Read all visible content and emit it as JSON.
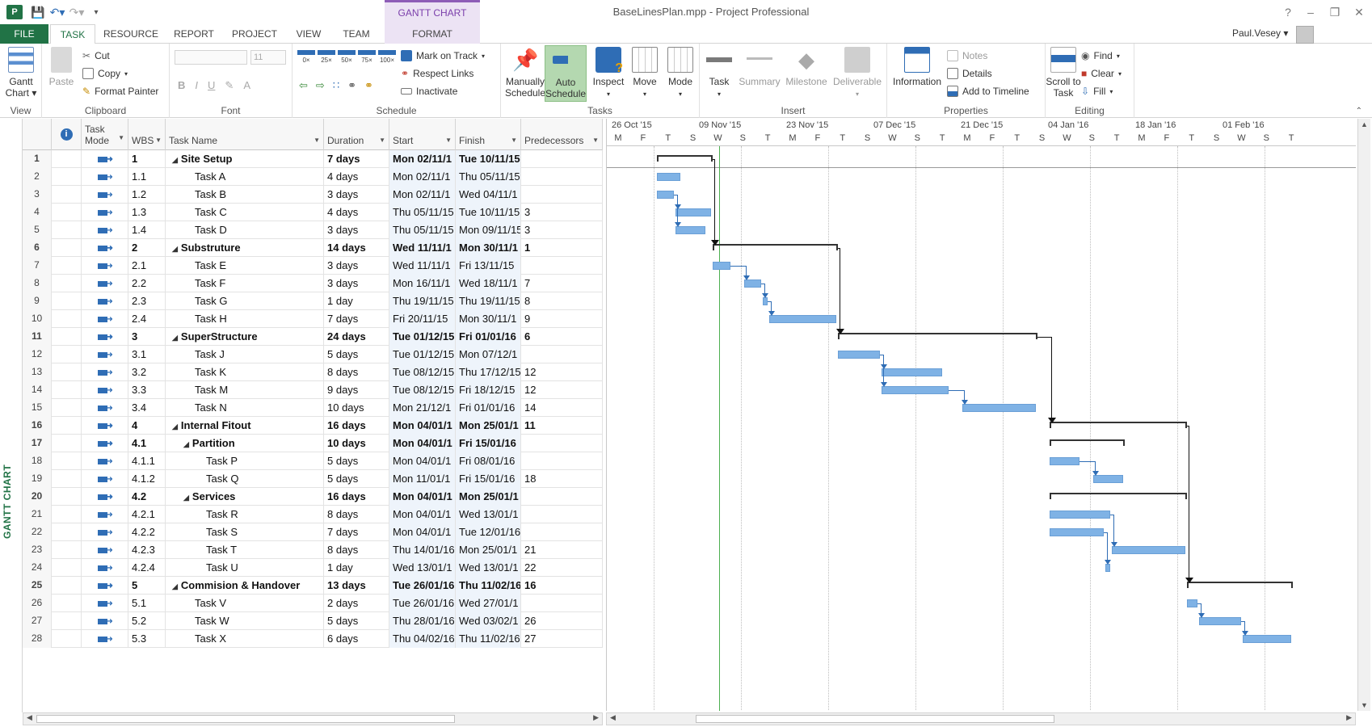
{
  "window": {
    "title": "BaseLinesPlan.mpp - Project Professional",
    "context_tab_title": "GANTT CHART TOOLS",
    "user": "Paul.Vesey",
    "help": "?",
    "minimize": "–",
    "restore": "❐",
    "close": "✕"
  },
  "tabs": [
    "FILE",
    "TASK",
    "RESOURCE",
    "REPORT",
    "PROJECT",
    "VIEW",
    "TEAM",
    "FORMAT"
  ],
  "ribbon": {
    "view": {
      "label": "View",
      "gantt_chart": "Gantt Chart ▾"
    },
    "clipboard": {
      "label": "Clipboard",
      "paste": "Paste",
      "cut": "Cut",
      "copy": "Copy",
      "format_painter": "Format Painter"
    },
    "font": {
      "label": "Font",
      "size": "11",
      "bold": "B",
      "italic": "I",
      "underline": "U",
      "font_color": "A"
    },
    "schedule": {
      "label": "Schedule",
      "pct": [
        "0×",
        "25×",
        "50×",
        "75×",
        "100×"
      ],
      "mark_on_track": "Mark on Track",
      "respect_links": "Respect Links",
      "inactivate": "Inactivate"
    },
    "tasks": {
      "label": "Tasks",
      "manually_schedule": "Manually Schedule",
      "auto_schedule": "Auto Schedule",
      "inspect": "Inspect",
      "move": "Move",
      "mode": "Mode"
    },
    "insert": {
      "label": "Insert",
      "task": "Task",
      "summary": "Summary",
      "milestone": "Milestone",
      "deliverable": "Deliverable"
    },
    "properties": {
      "label": "Properties",
      "information": "Information",
      "notes": "Notes",
      "details": "Details",
      "add_to_timeline": "Add to Timeline"
    },
    "editing": {
      "label": "Editing",
      "scroll_to_task": "Scroll to Task",
      "find": "Find",
      "clear": "Clear",
      "fill": "Fill"
    }
  },
  "view_bar_label": "GANTT CHART",
  "grid": {
    "headers": {
      "task_mode": "Task Mode",
      "wbs": "WBS",
      "task_name": "Task Name",
      "duration": "Duration",
      "start": "Start",
      "finish": "Finish",
      "predecessors": "Predecessors"
    },
    "rows": [
      {
        "id": "1",
        "wbs": "1",
        "name": "Site Setup",
        "dur": "7 days",
        "start": "Mon 02/11/1",
        "finish": "Tue 10/11/15",
        "pred": "",
        "lvl": 0,
        "sum": true
      },
      {
        "id": "2",
        "wbs": "1.1",
        "name": "Task A",
        "dur": "4 days",
        "start": "Mon 02/11/1",
        "finish": "Thu 05/11/15",
        "pred": "",
        "lvl": 1,
        "sum": false
      },
      {
        "id": "3",
        "wbs": "1.2",
        "name": "Task B",
        "dur": "3 days",
        "start": "Mon 02/11/1",
        "finish": "Wed 04/11/1",
        "pred": "",
        "lvl": 1,
        "sum": false
      },
      {
        "id": "4",
        "wbs": "1.3",
        "name": "Task C",
        "dur": "4 days",
        "start": "Thu 05/11/15",
        "finish": "Tue 10/11/15",
        "pred": "3",
        "lvl": 1,
        "sum": false
      },
      {
        "id": "5",
        "wbs": "1.4",
        "name": "Task D",
        "dur": "3 days",
        "start": "Thu 05/11/15",
        "finish": "Mon 09/11/15",
        "pred": "3",
        "lvl": 1,
        "sum": false
      },
      {
        "id": "6",
        "wbs": "2",
        "name": "Substruture",
        "dur": "14 days",
        "start": "Wed 11/11/1",
        "finish": "Mon 30/11/1",
        "pred": "1",
        "lvl": 0,
        "sum": true
      },
      {
        "id": "7",
        "wbs": "2.1",
        "name": "Task E",
        "dur": "3 days",
        "start": "Wed 11/11/1",
        "finish": "Fri 13/11/15",
        "pred": "",
        "lvl": 1,
        "sum": false
      },
      {
        "id": "8",
        "wbs": "2.2",
        "name": "Task F",
        "dur": "3 days",
        "start": "Mon 16/11/1",
        "finish": "Wed 18/11/1",
        "pred": "7",
        "lvl": 1,
        "sum": false
      },
      {
        "id": "9",
        "wbs": "2.3",
        "name": "Task G",
        "dur": "1 day",
        "start": "Thu 19/11/15",
        "finish": "Thu 19/11/15",
        "pred": "8",
        "lvl": 1,
        "sum": false
      },
      {
        "id": "10",
        "wbs": "2.4",
        "name": "Task H",
        "dur": "7 days",
        "start": "Fri 20/11/15",
        "finish": "Mon 30/11/1",
        "pred": "9",
        "lvl": 1,
        "sum": false
      },
      {
        "id": "11",
        "wbs": "3",
        "name": "SuperStructure",
        "dur": "24 days",
        "start": "Tue 01/12/15",
        "finish": "Fri 01/01/16",
        "pred": "6",
        "lvl": 0,
        "sum": true
      },
      {
        "id": "12",
        "wbs": "3.1",
        "name": "Task J",
        "dur": "5 days",
        "start": "Tue 01/12/15",
        "finish": "Mon 07/12/1",
        "pred": "",
        "lvl": 1,
        "sum": false
      },
      {
        "id": "13",
        "wbs": "3.2",
        "name": "Task K",
        "dur": "8 days",
        "start": "Tue 08/12/15",
        "finish": "Thu 17/12/15",
        "pred": "12",
        "lvl": 1,
        "sum": false
      },
      {
        "id": "14",
        "wbs": "3.3",
        "name": "Task M",
        "dur": "9 days",
        "start": "Tue 08/12/15",
        "finish": "Fri 18/12/15",
        "pred": "12",
        "lvl": 1,
        "sum": false
      },
      {
        "id": "15",
        "wbs": "3.4",
        "name": "Task N",
        "dur": "10 days",
        "start": "Mon 21/12/1",
        "finish": "Fri 01/01/16",
        "pred": "14",
        "lvl": 1,
        "sum": false
      },
      {
        "id": "16",
        "wbs": "4",
        "name": "Internal Fitout",
        "dur": "16 days",
        "start": "Mon 04/01/1",
        "finish": "Mon 25/01/1",
        "pred": "11",
        "lvl": 0,
        "sum": true
      },
      {
        "id": "17",
        "wbs": "4.1",
        "name": "Partition",
        "dur": "10 days",
        "start": "Mon 04/01/1",
        "finish": "Fri 15/01/16",
        "pred": "",
        "lvl": 1,
        "sum": true
      },
      {
        "id": "18",
        "wbs": "4.1.1",
        "name": "Task P",
        "dur": "5 days",
        "start": "Mon 04/01/1",
        "finish": "Fri 08/01/16",
        "pred": "",
        "lvl": 2,
        "sum": false
      },
      {
        "id": "19",
        "wbs": "4.1.2",
        "name": "Task Q",
        "dur": "5 days",
        "start": "Mon 11/01/1",
        "finish": "Fri 15/01/16",
        "pred": "18",
        "lvl": 2,
        "sum": false
      },
      {
        "id": "20",
        "wbs": "4.2",
        "name": "Services",
        "dur": "16 days",
        "start": "Mon 04/01/1",
        "finish": "Mon 25/01/1",
        "pred": "",
        "lvl": 1,
        "sum": true
      },
      {
        "id": "21",
        "wbs": "4.2.1",
        "name": "Task R",
        "dur": "8 days",
        "start": "Mon 04/01/1",
        "finish": "Wed 13/01/1",
        "pred": "",
        "lvl": 2,
        "sum": false
      },
      {
        "id": "22",
        "wbs": "4.2.2",
        "name": "Task S",
        "dur": "7 days",
        "start": "Mon 04/01/1",
        "finish": "Tue 12/01/16",
        "pred": "",
        "lvl": 2,
        "sum": false
      },
      {
        "id": "23",
        "wbs": "4.2.3",
        "name": "Task T",
        "dur": "8 days",
        "start": "Thu 14/01/16",
        "finish": "Mon 25/01/1",
        "pred": "21",
        "lvl": 2,
        "sum": false
      },
      {
        "id": "24",
        "wbs": "4.2.4",
        "name": "Task U",
        "dur": "1 day",
        "start": "Wed 13/01/1",
        "finish": "Wed 13/01/1",
        "pred": "22",
        "lvl": 2,
        "sum": false
      },
      {
        "id": "25",
        "wbs": "5",
        "name": "Commision & Handover",
        "dur": "13 days",
        "start": "Tue 26/01/16",
        "finish": "Thu 11/02/16",
        "pred": "16",
        "lvl": 0,
        "sum": true
      },
      {
        "id": "26",
        "wbs": "5.1",
        "name": "Task V",
        "dur": "2 days",
        "start": "Tue 26/01/16",
        "finish": "Wed 27/01/1",
        "pred": "",
        "lvl": 1,
        "sum": false
      },
      {
        "id": "27",
        "wbs": "5.2",
        "name": "Task W",
        "dur": "5 days",
        "start": "Thu 28/01/16",
        "finish": "Wed 03/02/1",
        "pred": "26",
        "lvl": 1,
        "sum": false
      },
      {
        "id": "28",
        "wbs": "5.3",
        "name": "Task X",
        "dur": "6 days",
        "start": "Thu 04/02/16",
        "finish": "Thu 11/02/16",
        "pred": "27",
        "lvl": 1,
        "sum": false
      }
    ]
  },
  "gantt": {
    "weeks": [
      "26 Oct '15",
      "09 Nov '15",
      "23 Nov '15",
      "07 Dec '15",
      "21 Dec '15",
      "04 Jan '16",
      "18 Jan '16",
      "01 Feb '16"
    ],
    "day_labels": [
      "M",
      "F",
      "T",
      "S",
      "W",
      "S",
      "T",
      "M",
      "F",
      "T",
      "S",
      "W",
      "S",
      "T",
      "M",
      "F",
      "T",
      "S",
      "W",
      "S",
      "T",
      "M",
      "F",
      "T",
      "S",
      "W",
      "S",
      "T"
    ],
    "timescale_start": "2015-10-26",
    "status_date": "2015-11-12"
  }
}
